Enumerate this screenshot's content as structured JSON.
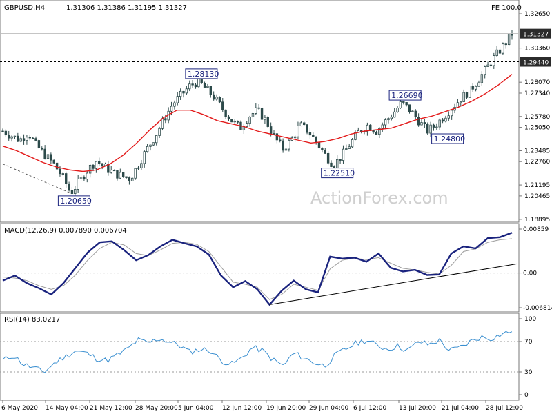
{
  "chart_data": [
    {
      "type": "candlestick",
      "symbol_label": "GBPUSD,H4",
      "ohlc_label": "1.31306 1.31386 1.31195 1.31327",
      "fe_label": "FE 100.0",
      "watermark": "ActionForex.com",
      "y_ticks": [
        "1.32650",
        "1.30360",
        "1.28070",
        "1.25780",
        "1.23485",
        "1.21195",
        "1.18895",
        "1.20465",
        "1.22760",
        "1.25050",
        "1.27340",
        "1.29440",
        "1.31327"
      ],
      "ylim": [
        1.1889,
        1.3265
      ],
      "current_price": 1.31327,
      "current_price_label": "1.31327",
      "level_line": 1.2944,
      "level_line_label": "1.29440",
      "annotations": [
        {
          "label": "1.20650",
          "value": 1.2065
        },
        {
          "label": "1.28130",
          "value": 1.2813
        },
        {
          "label": "1.22510",
          "value": 1.2251
        },
        {
          "label": "1.26690",
          "value": 1.2669
        },
        {
          "label": "1.24800",
          "value": 1.248
        }
      ],
      "price_path": [
        1.248,
        1.245,
        1.242,
        1.247,
        1.238,
        1.232,
        1.226,
        1.218,
        1.2065,
        1.214,
        1.222,
        1.228,
        1.224,
        1.22,
        1.218,
        1.216,
        1.226,
        1.236,
        1.245,
        1.256,
        1.266,
        1.272,
        1.278,
        1.2813,
        1.276,
        1.27,
        1.262,
        1.255,
        1.25,
        1.258,
        1.262,
        1.255,
        1.244,
        1.236,
        1.242,
        1.252,
        1.248,
        1.24,
        1.232,
        1.2251,
        1.232,
        1.24,
        1.248,
        1.252,
        1.248,
        1.254,
        1.26,
        1.2669,
        1.262,
        1.255,
        1.248,
        1.252,
        1.258,
        1.264,
        1.27,
        1.275,
        1.282,
        1.29,
        1.298,
        1.305,
        1.31327
      ],
      "ma_path": [
        1.238,
        1.235,
        1.231,
        1.227,
        1.224,
        1.222,
        1.221,
        1.222,
        1.226,
        1.232,
        1.24,
        1.249,
        1.257,
        1.262,
        1.262,
        1.259,
        1.255,
        1.253,
        1.251,
        1.248,
        1.246,
        1.244,
        1.242,
        1.24,
        1.241,
        1.243,
        1.246,
        1.248,
        1.249,
        1.25,
        1.253,
        1.256,
        1.258,
        1.261,
        1.264,
        1.268,
        1.273,
        1.279,
        1.286
      ]
    },
    {
      "type": "line",
      "title": "MACD(12,26,9) 0.007890 0.006704",
      "y_ticks": [
        "0.00859",
        "0.00",
        "-0.006814"
      ],
      "ylim": [
        -0.006814,
        0.00859
      ],
      "macd_path": [
        -0.0015,
        -0.0005,
        -0.002,
        -0.003,
        -0.0042,
        -0.002,
        0.001,
        0.004,
        0.006,
        0.0062,
        0.0045,
        0.0025,
        0.0035,
        0.0052,
        0.0065,
        0.0058,
        0.0052,
        0.0036,
        -0.0005,
        -0.0028,
        -0.0016,
        -0.0032,
        -0.0062,
        -0.0035,
        -0.0015,
        -0.0032,
        -0.0038,
        0.0032,
        0.0028,
        0.003,
        0.0022,
        0.0038,
        0.001,
        0.0003,
        0.0006,
        -0.0004,
        -0.0003,
        0.0038,
        0.0052,
        0.0048,
        0.0068,
        0.007,
        0.00789
      ],
      "signal_path": [
        -0.0008,
        -0.001,
        -0.0015,
        -0.0025,
        -0.0032,
        -0.0025,
        -0.0004,
        0.0025,
        0.0048,
        0.006,
        0.0055,
        0.0038,
        0.0034,
        0.0045,
        0.0058,
        0.006,
        0.0056,
        0.0042,
        0.0012,
        -0.0018,
        -0.0022,
        -0.0028,
        -0.0052,
        -0.0042,
        -0.0022,
        -0.0028,
        -0.0034,
        0.0008,
        0.0025,
        0.0029,
        0.0026,
        0.003,
        0.0019,
        0.0009,
        0.0006,
        0.0001,
        -0.0002,
        0.0015,
        0.0042,
        0.0047,
        0.006,
        0.0065,
        0.006704
      ],
      "trendline": [
        [
          -0.0062,
          0.0018
        ]
      ]
    },
    {
      "type": "line",
      "title": "RSI(14) 83.0217",
      "y_ticks": [
        "100",
        "70",
        "30",
        "0"
      ],
      "ylim": [
        0,
        100
      ],
      "levels": [
        70,
        30
      ],
      "rsi_path": [
        45,
        52,
        40,
        35,
        30,
        42,
        50,
        58,
        55,
        48,
        45,
        52,
        60,
        72,
        68,
        74,
        70,
        65,
        56,
        60,
        58,
        45,
        40,
        48,
        62,
        58,
        46,
        38,
        55,
        48,
        42,
        38,
        52,
        60,
        68,
        72,
        65,
        60,
        64,
        58,
        70,
        66,
        72,
        58,
        62,
        70,
        76,
        74,
        80,
        83.0217
      ]
    }
  ],
  "x_ticks": [
    "6 May 2020",
    "14 May 04:00",
    "21 May 12:00",
    "28 May 20:00",
    "5 Jun 04:00",
    "12 Jun 12:00",
    "19 Jun 20:00",
    "29 Jun 04:00",
    "6 Jul 12:00",
    "13 Jul 20:00",
    "21 Jul 04:00",
    "28 Jul 12:00"
  ],
  "colors": {
    "candle": "#2d4a4a",
    "ma": "#e31a1a",
    "macd": "#1a237e",
    "signal": "#9e9e9e",
    "rsi": "#3a8fd0",
    "level": "#000000",
    "annotation": "#1a237e",
    "watermark": "#cfcfcf"
  }
}
